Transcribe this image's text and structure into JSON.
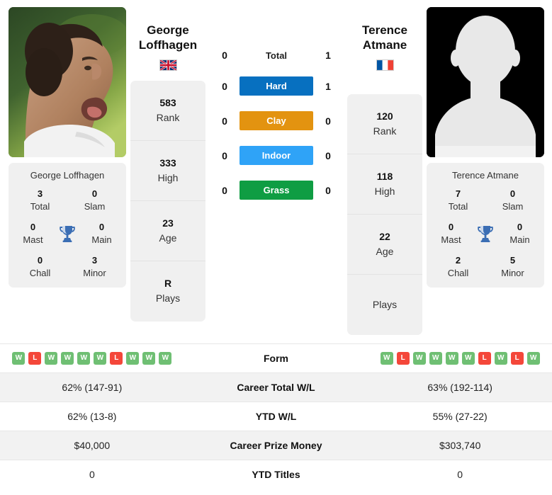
{
  "players": {
    "left": {
      "name": "George Loffhagen",
      "name_line1": "George",
      "name_line2": "Loffhagen",
      "caption": "George Loffhagen",
      "country": "GB",
      "flag_icon": "uk-flag-icon",
      "info": [
        {
          "value": "583",
          "label": "Rank"
        },
        {
          "value": "333",
          "label": "High"
        },
        {
          "value": "23",
          "label": "Age"
        },
        {
          "value": "R",
          "label": "Plays"
        }
      ],
      "titles": [
        {
          "value": "3",
          "label": "Total"
        },
        {
          "value": "0",
          "label": "Slam"
        },
        {
          "value": "0",
          "label": "Mast"
        },
        {
          "value": "0",
          "label": "Main"
        },
        {
          "value": "0",
          "label": "Chall"
        },
        {
          "value": "3",
          "label": "Minor"
        }
      ],
      "form": [
        "W",
        "L",
        "W",
        "W",
        "W",
        "W",
        "L",
        "W",
        "W",
        "W"
      ]
    },
    "right": {
      "name": "Terence Atmane",
      "name_line1": "Terence",
      "name_line2": "Atmane",
      "caption": "Terence Atmane",
      "country": "FR",
      "flag_icon": "france-flag-icon",
      "info": [
        {
          "value": "120",
          "label": "Rank"
        },
        {
          "value": "118",
          "label": "High"
        },
        {
          "value": "22",
          "label": "Age"
        },
        {
          "value": "",
          "label": "Plays"
        }
      ],
      "titles": [
        {
          "value": "7",
          "label": "Total"
        },
        {
          "value": "0",
          "label": "Slam"
        },
        {
          "value": "0",
          "label": "Mast"
        },
        {
          "value": "0",
          "label": "Main"
        },
        {
          "value": "2",
          "label": "Chall"
        },
        {
          "value": "5",
          "label": "Minor"
        }
      ],
      "form": [
        "W",
        "L",
        "W",
        "W",
        "W",
        "W",
        "L",
        "W",
        "L",
        "W"
      ]
    }
  },
  "h2h": [
    {
      "label": "Total",
      "left": "0",
      "right": "1",
      "type": "plain",
      "color": ""
    },
    {
      "label": "Hard",
      "left": "0",
      "right": "1",
      "type": "badge",
      "color": "#0770c0"
    },
    {
      "label": "Clay",
      "left": "0",
      "right": "0",
      "type": "badge",
      "color": "#e39310"
    },
    {
      "label": "Indoor",
      "left": "0",
      "right": "0",
      "type": "badge",
      "color": "#2fa3f7"
    },
    {
      "label": "Grass",
      "left": "0",
      "right": "0",
      "type": "badge",
      "color": "#0f9d43"
    }
  ],
  "table": {
    "form_label": "Form",
    "rows": [
      {
        "label": "Career Total W/L",
        "left": "62% (147-91)",
        "right": "63% (192-114)"
      },
      {
        "label": "YTD W/L",
        "left": "62% (13-8)",
        "right": "55% (27-22)"
      },
      {
        "label": "Career Prize Money",
        "left": "$40,000",
        "right": "$303,740"
      },
      {
        "label": "YTD Titles",
        "left": "0",
        "right": "0"
      }
    ]
  },
  "colors": {
    "win": "#6fbf73",
    "loss": "#f4473a",
    "trophy": "#3b6eb4",
    "card_bg": "#f0f0f0",
    "row_shade": "#f2f2f2"
  },
  "icons": {
    "trophy": "trophy-icon",
    "player_photo": "player-photo",
    "player_placeholder": "player-placeholder-avatar"
  }
}
